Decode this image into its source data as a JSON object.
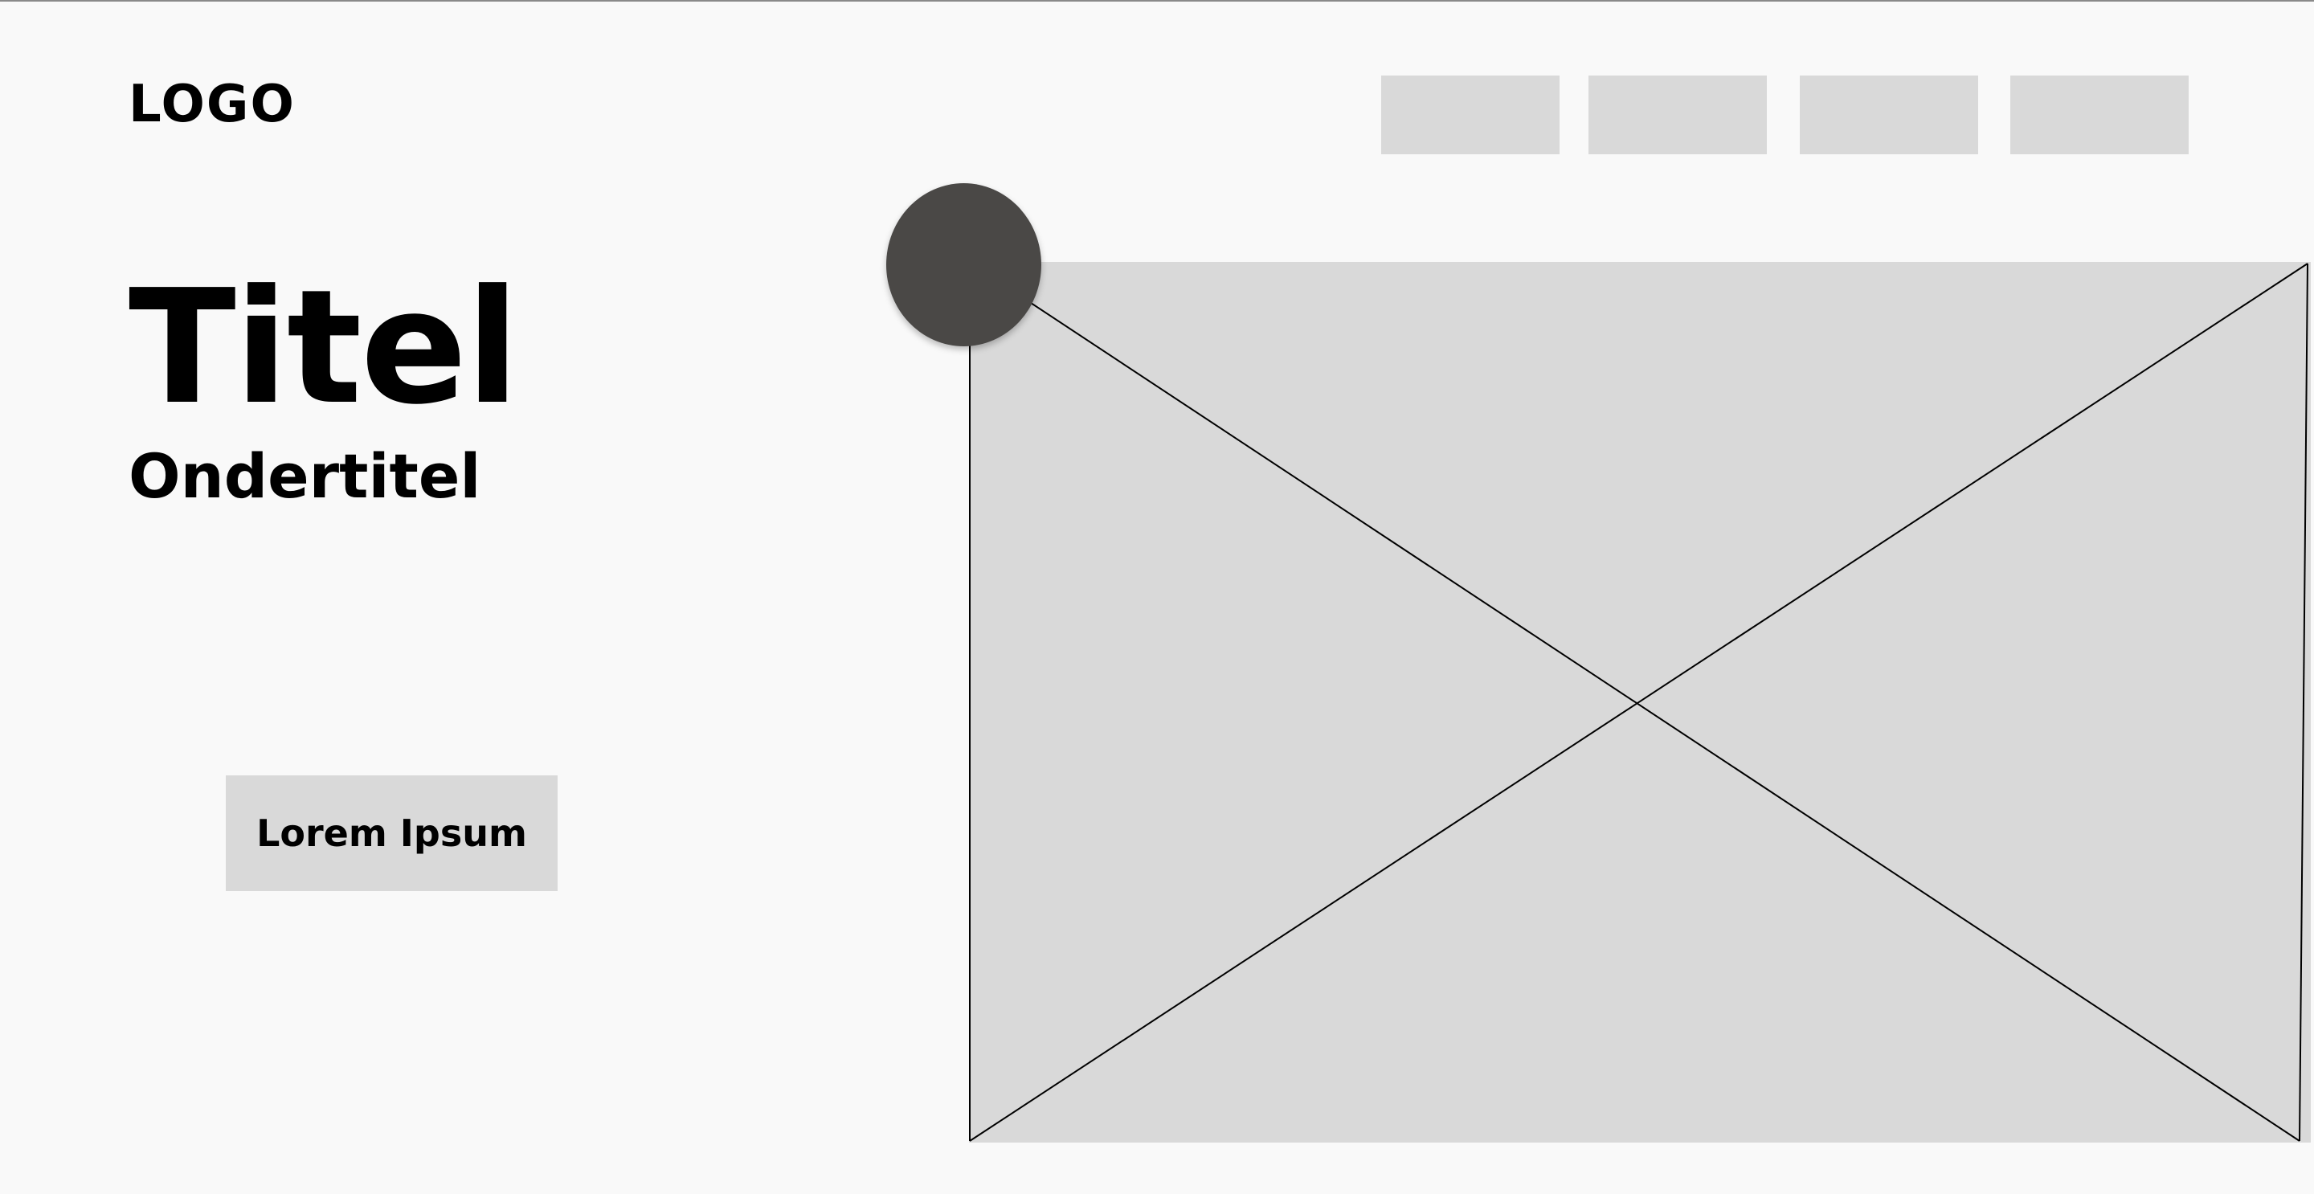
{
  "header": {
    "logo_text": "LOGO",
    "nav_items": [
      {
        "label": ""
      },
      {
        "label": ""
      },
      {
        "label": ""
      },
      {
        "label": ""
      }
    ]
  },
  "hero": {
    "title": "Titel",
    "subtitle": "Ondertitel",
    "cta_label": "Lorem Ipsum"
  },
  "media": {
    "image_placeholder": "image-placeholder",
    "avatar_icon": "avatar-circle"
  },
  "colors": {
    "background": "#f9f9f9",
    "placeholder_fill": "#d9d9d9",
    "avatar_fill": "#4a4846",
    "text": "#000000"
  }
}
